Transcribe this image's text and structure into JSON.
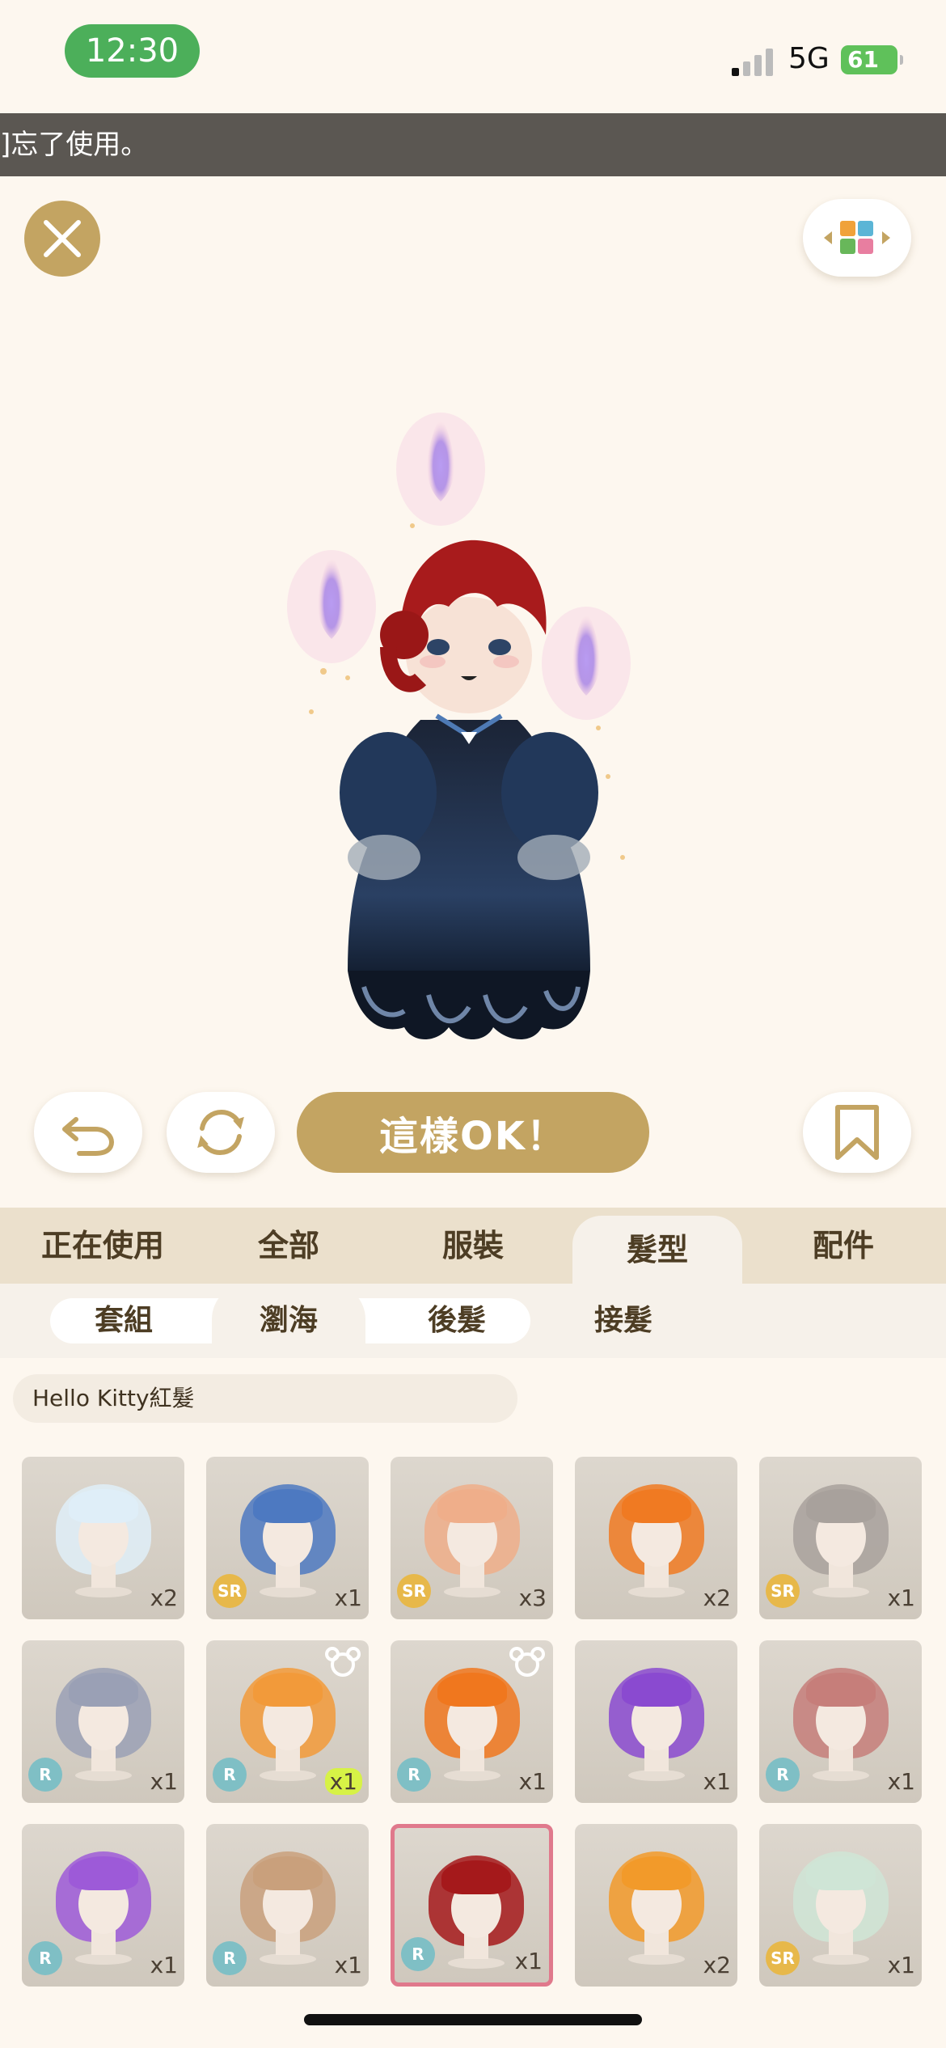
{
  "status_bar": {
    "time": "12:30",
    "network": "5G",
    "battery": "61"
  },
  "banner": {
    "text": "]忘了使用。"
  },
  "toolbar": {
    "ok_label": "這樣OK！"
  },
  "category_tabs": [
    {
      "label": "正在使用",
      "active": false
    },
    {
      "label": "全部",
      "active": false
    },
    {
      "label": "服裝",
      "active": false
    },
    {
      "label": "髮型",
      "active": true
    },
    {
      "label": "配件",
      "active": false
    }
  ],
  "sub_tabs": [
    {
      "label": "套組",
      "active": false
    },
    {
      "label": "瀏海",
      "active": true
    },
    {
      "label": "後髮",
      "active": false
    },
    {
      "label": "接髮",
      "active": false
    }
  ],
  "selected_item_name": "Hello Kitty紅髮",
  "items": [
    {
      "hair": "white-blue",
      "color": "#dfeef8",
      "rarity": "",
      "count": "x2",
      "bear": false,
      "selected": false
    },
    {
      "hair": "blue-curls",
      "color": "#4d79c1",
      "rarity": "SR",
      "count": "x1",
      "bear": false,
      "selected": false
    },
    {
      "hair": "peach-faded",
      "color": "#efae8a",
      "rarity": "SR",
      "count": "x3",
      "bear": false,
      "selected": false
    },
    {
      "hair": "orange-bob",
      "color": "#f07a22",
      "rarity": "",
      "count": "x2",
      "bear": false,
      "selected": false
    },
    {
      "hair": "gray-long",
      "color": "#a8a19c",
      "rarity": "SR",
      "count": "x1",
      "bear": false,
      "selected": false
    },
    {
      "hair": "gray-blue-short",
      "color": "#9aa0b5",
      "rarity": "R",
      "count": "x1",
      "bear": false,
      "selected": false
    },
    {
      "hair": "orange-white",
      "color": "#f29a3a",
      "rarity": "R",
      "count": "x1",
      "bear": true,
      "selected": false,
      "count_highlight": true
    },
    {
      "hair": "orange-bowl",
      "color": "#f0771e",
      "rarity": "R",
      "count": "x1",
      "bear": true,
      "selected": false
    },
    {
      "hair": "black-purple",
      "color": "#8a4ad0",
      "rarity": "",
      "count": "x1",
      "bear": false,
      "selected": false
    },
    {
      "hair": "rose-brown",
      "color": "#c67e7a",
      "rarity": "R",
      "count": "x1",
      "bear": false,
      "selected": false
    },
    {
      "hair": "purple-green",
      "color": "#9d5ad8",
      "rarity": "R",
      "count": "x1",
      "bear": false,
      "selected": false
    },
    {
      "hair": "light-brown-wavy",
      "color": "#c9a07c",
      "rarity": "R",
      "count": "x1",
      "bear": false,
      "selected": false
    },
    {
      "hair": "red-bob",
      "color": "#a5191b",
      "rarity": "R",
      "count": "x1",
      "bear": false,
      "selected": true
    },
    {
      "hair": "orange-afro",
      "color": "#f29a2a",
      "rarity": "",
      "count": "x2",
      "bear": false,
      "selected": false
    },
    {
      "hair": "mint-braids",
      "color": "#cfe5d6",
      "rarity": "SR",
      "count": "x1",
      "bear": false,
      "selected": false
    }
  ]
}
